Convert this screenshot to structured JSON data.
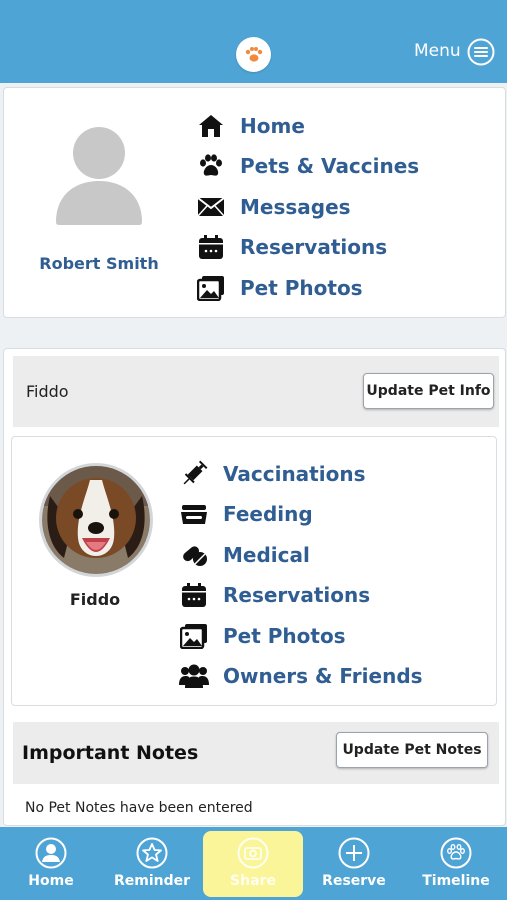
{
  "header": {
    "menu_label": "Menu",
    "logo_icon": "paw-logo-icon",
    "background": "#4fa4d6"
  },
  "profile": {
    "name": "Robert Smith",
    "nav": [
      {
        "label": "Home",
        "icon": "home-icon"
      },
      {
        "label": "Pets & Vaccines",
        "icon": "paw-icon"
      },
      {
        "label": "Messages",
        "icon": "envelope-icon"
      },
      {
        "label": "Reservations",
        "icon": "calendar-icon"
      },
      {
        "label": "Pet Photos",
        "icon": "photos-icon"
      }
    ]
  },
  "pet": {
    "bar_name": "Fiddo",
    "update_info_label": "Update Pet Info",
    "name": "Fiddo",
    "nav": [
      {
        "label": "Vaccinations",
        "icon": "syringe-icon"
      },
      {
        "label": "Feeding",
        "icon": "food-bowl-icon"
      },
      {
        "label": "Medical",
        "icon": "pills-icon"
      },
      {
        "label": "Reservations",
        "icon": "calendar-icon"
      },
      {
        "label": "Pet Photos",
        "icon": "photos-icon"
      },
      {
        "label": "Owners & Friends",
        "icon": "users-icon"
      }
    ]
  },
  "notes": {
    "title": "Important Notes",
    "update_label": "Update Pet Notes",
    "empty_text": "No Pet Notes have been entered"
  },
  "tabbar": {
    "tabs": [
      {
        "label": "Home",
        "icon": "person-circle-icon"
      },
      {
        "label": "Reminder",
        "icon": "star-circle-icon"
      },
      {
        "label": "Share",
        "icon": "camera-circle-icon",
        "active": true
      },
      {
        "label": "Reserve",
        "icon": "plus-circle-icon"
      },
      {
        "label": "Timeline",
        "icon": "paw-circle-icon"
      }
    ]
  },
  "colors": {
    "accent": "#4fa4d6",
    "link": "#305e92",
    "active_tab": "#fbf59a"
  }
}
